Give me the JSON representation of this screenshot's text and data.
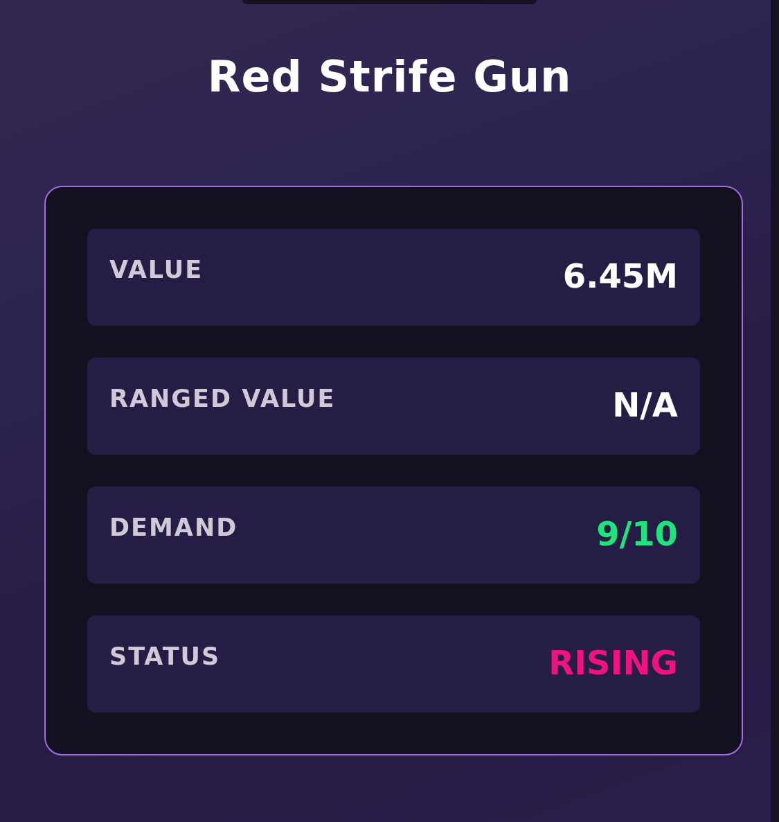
{
  "title": "Red Strife Gun",
  "stats": [
    {
      "label": "VALUE",
      "value": "6.45M",
      "color": "#ffffff"
    },
    {
      "label": "RANGED VALUE",
      "value": "N/A",
      "color": "#ffffff"
    },
    {
      "label": "DEMAND",
      "value": "9/10",
      "color": "#1fe47c"
    },
    {
      "label": "STATUS",
      "value": "RISING",
      "color": "#f2127f"
    }
  ]
}
